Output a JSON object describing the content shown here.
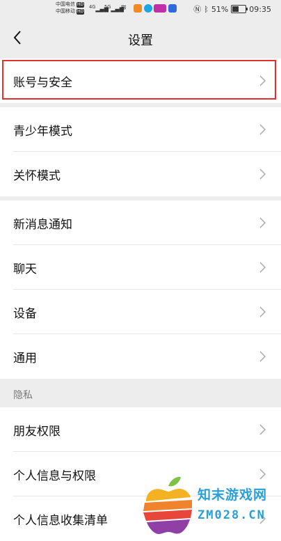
{
  "status_bar": {
    "carrier1": "中国电信",
    "carrier2": "中国移动",
    "hd": "HD",
    "net1": "4G",
    "net2": "5G",
    "battery": "51%",
    "time": "09:35"
  },
  "nav": {
    "title": "设置"
  },
  "groups": {
    "account": [
      "账号与安全"
    ],
    "modes": [
      "青少年模式",
      "关怀模式"
    ],
    "general": [
      "新消息通知",
      "聊天",
      "设备",
      "通用"
    ],
    "privacy_header": "隐私",
    "privacy": [
      "朋友权限",
      "个人信息与权限",
      "个人信息收集清单"
    ]
  },
  "watermark": {
    "title": "知末游戏网",
    "url": "ZM028.CN"
  },
  "colors": {
    "highlight": "#e03030",
    "watermark_text": "#2aa0d8"
  }
}
